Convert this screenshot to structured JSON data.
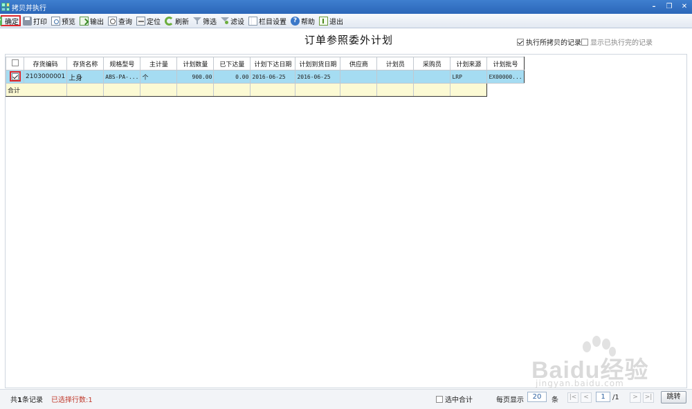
{
  "window": {
    "title": "拷贝并执行"
  },
  "toolbar": {
    "confirm": "确定",
    "print": "打印",
    "preview": "预览",
    "export": "输出",
    "query": "查询",
    "locate": "定位",
    "refresh": "刷新",
    "filter": "筛选",
    "filter_settings": "滤设",
    "column_settings": "栏目设置",
    "help": "帮助",
    "exit": "退出"
  },
  "page_title": "订单参照委外计划",
  "options": {
    "exec_copied": {
      "label": "执行所拷贝的记录",
      "checked": true
    },
    "show_executed": {
      "label": "显示已执行完的记录",
      "checked": false
    }
  },
  "table": {
    "headers": [
      "存货编码",
      "存货名称",
      "规格型号",
      "主计量",
      "计划数量",
      "已下达量",
      "计划下达日期",
      "计划到货日期",
      "供应商",
      "计划员",
      "采购员",
      "计划来源",
      "计划批号"
    ],
    "rows": [
      {
        "selected": true,
        "cells": [
          "2103000001",
          "上身",
          "ABS-PA-...",
          "个",
          "900.00",
          "0.00",
          "2016-06-25",
          "2016-06-25",
          "",
          "",
          "",
          "LRP",
          "EX00000..."
        ]
      }
    ],
    "total_label": "合计"
  },
  "status": {
    "records_prefix": "共",
    "records_count": "1",
    "records_suffix": "条记录",
    "selected_rows": "已选择行数:1",
    "select_total_label": "选中合计",
    "per_page_label": "每页显示",
    "per_page_value": "20",
    "per_page_unit": "条",
    "current_page": "1",
    "total_pages": "/1",
    "jump": "跳转"
  },
  "watermark": {
    "brand": "Baidu经验",
    "url": "jingyan.baidu.com"
  }
}
